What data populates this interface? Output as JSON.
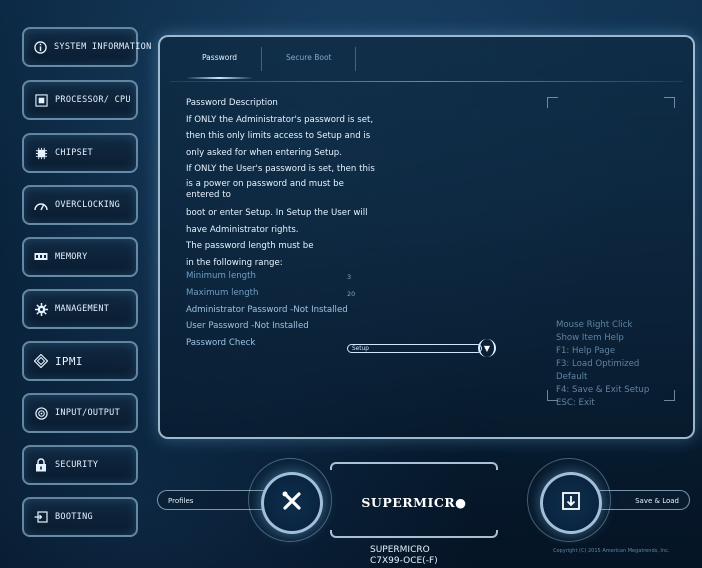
{
  "sidebar": {
    "items": [
      {
        "label": "SYSTEM INFORMATION",
        "icon": "info-icon"
      },
      {
        "label": "PROCESSOR/ CPU",
        "icon": "processor-icon"
      },
      {
        "label": "CHIPSET",
        "icon": "chipset-icon"
      },
      {
        "label": "OVERCLOCKING",
        "icon": "overclocking-icon"
      },
      {
        "label": "MEMORY",
        "icon": "memory-icon"
      },
      {
        "label": "MANAGEMENT",
        "icon": "gear-icon"
      },
      {
        "label": "IPMI",
        "icon": "ipmi-icon"
      },
      {
        "label": "INPUT/OUTPUT",
        "icon": "input-output-icon"
      },
      {
        "label": "SECURITY",
        "icon": "lock-icon"
      },
      {
        "label": "BOOTING",
        "icon": "boot-icon"
      }
    ]
  },
  "tabs": [
    {
      "label": "Password",
      "active": true
    },
    {
      "label": "Secure Boot",
      "active": false
    }
  ],
  "description": {
    "lines": [
      "Password Description",
      "If ONLY the Administrator's password is set,",
      "then this only limits access to Setup and is",
      "only asked for when entering Setup.",
      "If ONLY the User's password is set, then this",
      "is a power on password and must be",
      "entered to",
      "boot or enter Setup. In Setup the User will",
      "have Administrator rights.",
      "The password length must be",
      "in the following range:"
    ]
  },
  "fields": {
    "min_label": "Minimum length",
    "min_value": "3",
    "max_label": "Maximum length",
    "max_value": "20",
    "admin_pw": "Administrator Password -Not Installed",
    "user_pw": "User Password -Not Installed",
    "pw_check_label": "Password Check",
    "pw_check_value": "Setup"
  },
  "help": {
    "lines": [
      "Mouse Right Click",
      "Show Item Help",
      "F1: Help Page",
      "F3: Load Optimized",
      "Default",
      "F4: Save & Exit Setup",
      "ESC: Exit"
    ]
  },
  "bottom": {
    "profiles_label": "Profiles",
    "save_load_label": "Save & Load",
    "brand": "SUPERMICR●",
    "model_line1": "SUPERMICRO",
    "model_line2": "C7X99-OCE(-F)",
    "copyright": "Copyright (C) 2015 American Megatrends, Inc."
  },
  "colors": {
    "accent": "#cfe7ff",
    "background": "#0b2640",
    "dim_text": "#6f9fc7"
  }
}
